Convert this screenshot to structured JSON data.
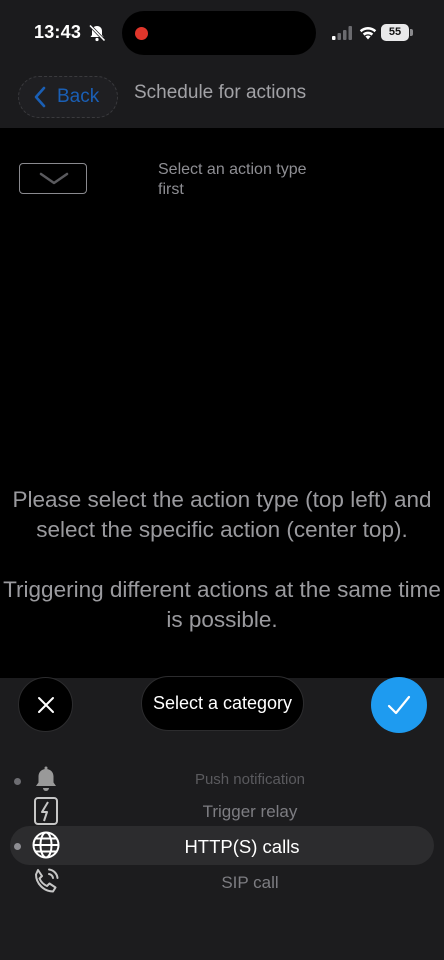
{
  "status_bar": {
    "time": "13:43",
    "battery_level": "55",
    "icons": [
      "bell-slash-icon",
      "recording-dot-icon",
      "cellular-signal-icon",
      "wifi-icon",
      "battery-icon"
    ]
  },
  "nav": {
    "back_label": "Back",
    "title": "Schedule for actions"
  },
  "main": {
    "action_type_placeholder": "Select an action type first",
    "instructions": [
      "Please select the action type (top left) and select the specific action (center top).",
      "Triggering different actions at the same time is possible."
    ]
  },
  "sheet": {
    "category_label": "Select a category",
    "categories": [
      {
        "label": "Push notification",
        "icon": "bell-icon",
        "selected": false
      },
      {
        "label": "Trigger relay",
        "icon": "relay-icon",
        "selected": false
      },
      {
        "label": "HTTP(S) calls",
        "icon": "globe-icon",
        "selected": true
      },
      {
        "label": "SIP call",
        "icon": "phone-ringing-icon",
        "selected": false
      }
    ]
  },
  "colors": {
    "accent_blue": "#1e9bf0",
    "back_link": "#1a5fb5",
    "background": "#000000",
    "sheet": "#1c1c1e"
  }
}
